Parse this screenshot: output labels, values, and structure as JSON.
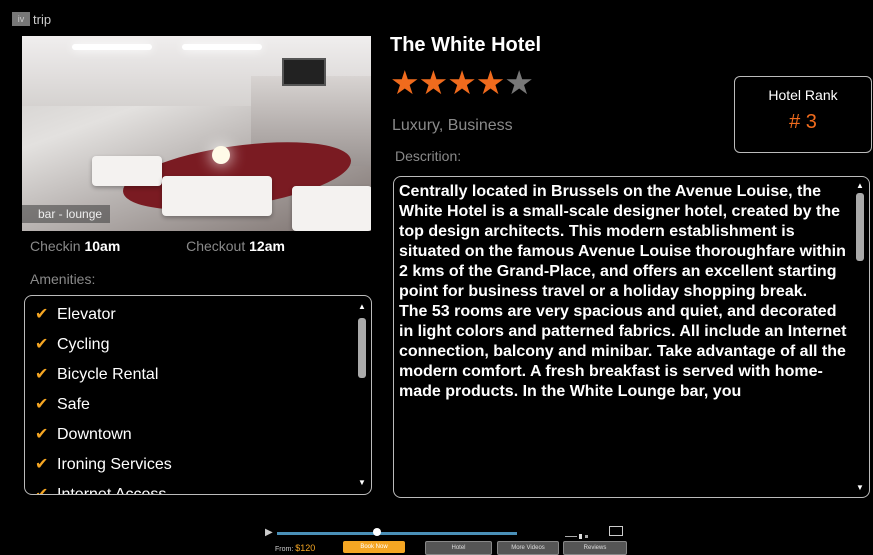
{
  "logo": {
    "mark": "iv",
    "text": "trip"
  },
  "photo": {
    "caption": "bar - lounge"
  },
  "checkin": {
    "label": "Checkin",
    "value": "10am"
  },
  "checkout": {
    "label": "Checkout",
    "value": "12am"
  },
  "amenities": {
    "label": "Amenities:",
    "items": [
      "Elevator",
      "Cycling",
      "Bicycle Rental",
      "Safe",
      "Downtown",
      "Ironing Services",
      "Internet Access"
    ]
  },
  "hotel": {
    "name": "The White Hotel",
    "rating": 4,
    "rating_max": 5,
    "category": "Luxury, Business"
  },
  "rank": {
    "label": "Hotel Rank",
    "value": "# 3"
  },
  "description": {
    "label": "Descrition:",
    "paragraphs": [
      "Centrally located in Brussels on the Avenue Louise, the White Hotel is a small-scale designer hotel, created by the top design architects. This modern establishment is situated on the famous Avenue Louise thoroughfare within 2 kms of the Grand-Place, and offers an excellent starting point for business travel or a holiday shopping break.",
      "The 53 rooms are very spacious and quiet, and decorated in light colors and patterned fabrics. All include an Internet connection, balcony and minibar. Take advantage of all the modern comfort. A fresh breakfast is served with home-made products. In the White Lounge bar, you"
    ]
  },
  "player": {
    "from_label": "From:",
    "price": "$120",
    "buttons": [
      "Book Now",
      "Hotel",
      "More Videos",
      "Reviews"
    ],
    "progress": 0.4
  },
  "colors": {
    "accent": "#f06b1d",
    "check": "#f5a623",
    "progress": "#4a90b8"
  },
  "icons": {
    "star": "star-icon",
    "check": "check-icon"
  }
}
